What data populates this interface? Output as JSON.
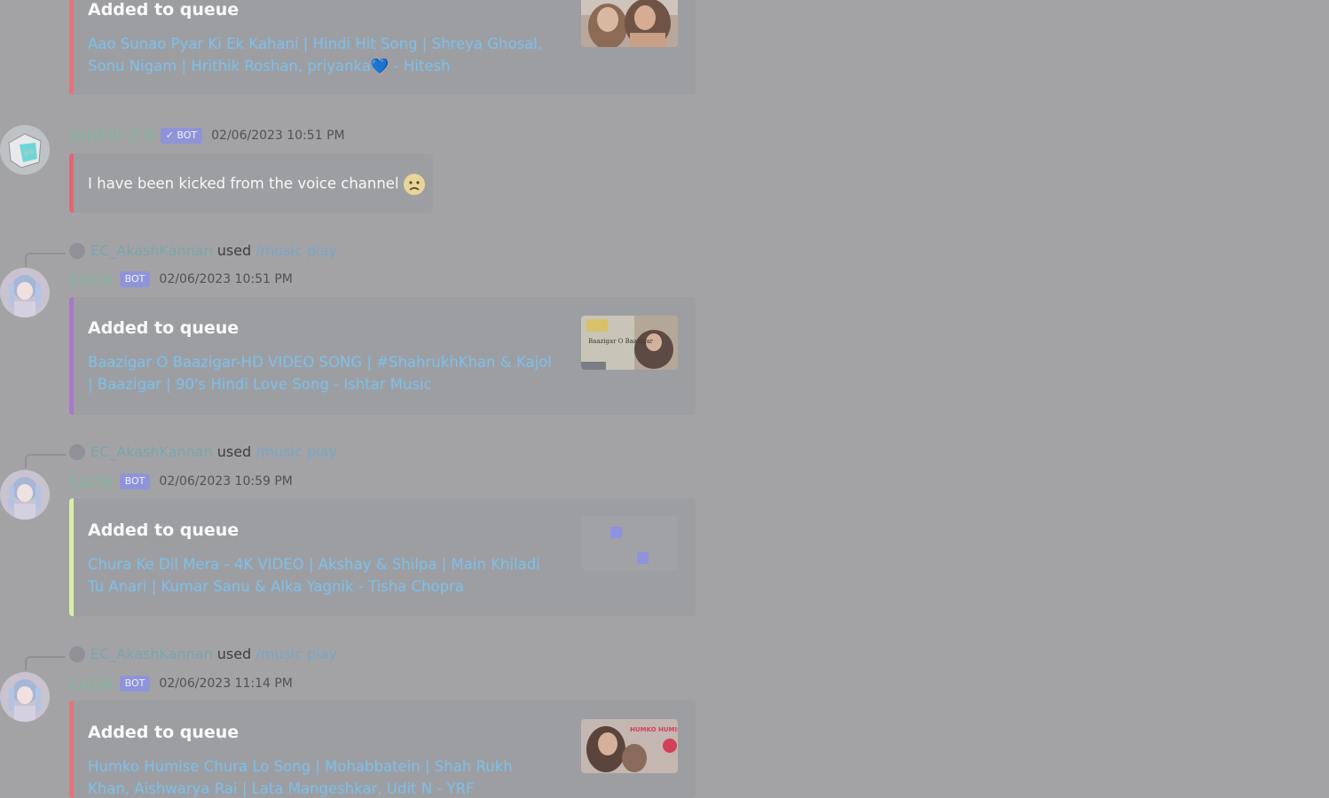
{
  "colors": {
    "background": "#a3a3a6",
    "username": "#7fb59a",
    "bot_tag": "#8f94d8",
    "link": "#7cc0ec",
    "bar_red": "#e06770",
    "bar_purple": "#a878c8",
    "bar_green": "#d9f0a8",
    "bar_pink": "#e5747d"
  },
  "messages": [
    {
      "embed_title": "Added to queue",
      "embed_desc": "Aao Sunao Pyar Ki Ek Kahani | Hindi Hit Song | Shreya Ghosal, Sonu Nigam | Hrithik Roshan, priyanka💙 - Hitesh"
    },
    {
      "username": "Ambili 2.0",
      "bot_tag": "✓ BOT",
      "timestamp": "02/06/2023 10:51 PM",
      "text": "I have been kicked from the voice channel"
    },
    {
      "reply_user": "EC_AkashKannan",
      "reply_used": "used",
      "reply_command": "/music play",
      "username": "Lucia",
      "bot_tag": "BOT",
      "timestamp": "02/06/2023 10:51 PM",
      "embed_title": "Added to queue",
      "embed_desc": "Baazigar O Baazigar-HD VIDEO SONG | #ShahrukhKhan & Kajol | Baazigar | 90's Hindi Love Song - Ishtar Music",
      "thumb_text": "Baazigar O Baazigar"
    },
    {
      "reply_user": "EC_AkashKannan",
      "reply_used": "used",
      "reply_command": "/music play",
      "username": "Lucia",
      "bot_tag": "BOT",
      "timestamp": "02/06/2023 10:59 PM",
      "embed_title": "Added to queue",
      "embed_desc": "Chura Ke Dil Mera - 4K VIDEO | Akshay & Shilpa | Main Khiladi Tu Anari | Kumar Sanu & Alka Yagnik - Tisha Chopra"
    },
    {
      "reply_user": "EC_AkashKannan",
      "reply_used": "used",
      "reply_command": "/music play",
      "username": "Lucia",
      "bot_tag": "BOT",
      "timestamp": "02/06/2023 11:14 PM",
      "embed_title": "Added to queue",
      "embed_desc": "Humko Humise Chura Lo Song | Mohabbatein | Shah Rukh Khan, Aishwarya Rai | Lata Mangeshkar, Udit N - YRF",
      "thumb_text": "HUMKO HUMISE CHURA LO"
    }
  ]
}
